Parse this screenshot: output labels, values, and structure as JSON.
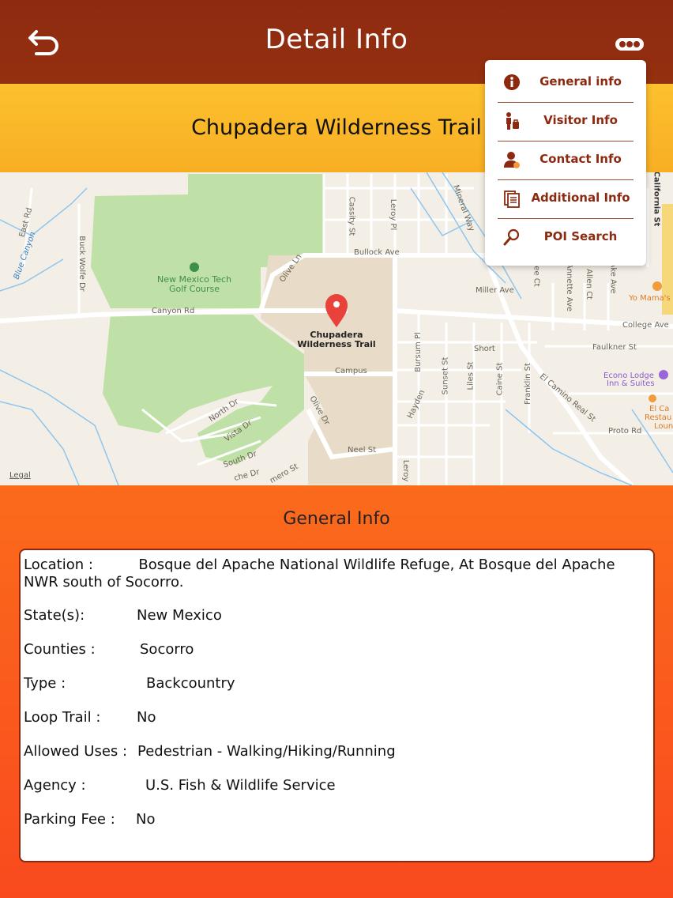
{
  "header": {
    "title": "Detail Info"
  },
  "trail": {
    "name": "Chupadera Wilderness Trail"
  },
  "map": {
    "pin_label": "Chupadera Wilderness Trail",
    "legal": "Legal",
    "golf_label": "New Mexico Tech Golf Course",
    "streets": {
      "east_rd": "East Rd",
      "buck_wolfe": "Buck Wolfe Dr",
      "blue_canyon": "Blue Canyon",
      "canyon_rd": "Canyon Rd",
      "olive_ln": "Olive Ln",
      "bullock": "Bullock Ave",
      "cassity": "Cassity St",
      "leroy": "Leroy Pl",
      "mineral": "Mineral Way",
      "miller": "Miller Ave",
      "campus": "Campus",
      "north_dr": "North Dr",
      "vista_dr": "Vista Dr",
      "south_dr": "South Dr",
      "olive_dr": "Olive Dr",
      "neel": "Neel St",
      "bursum": "Bursum Pl",
      "sunset": "Sunset St",
      "liles": "Liles St",
      "caine": "Caine St",
      "franklin": "Franklin St",
      "hayden": "Hayden",
      "el_camino": "El Camino Real St",
      "short": "Short",
      "faulkner": "Faulkner St",
      "college": "College Ave",
      "proto": "Proto Rd",
      "annette": "Annette Ave",
      "allen": "Allen Ct",
      "ake": "Ake Ave",
      "ee_ct": "ee Ct",
      "california": "California St",
      "leroy2": "Leroy",
      "che_dr": "che Dr",
      "mero": "mero St"
    },
    "pois": {
      "yo_mamas": "Yo Mama's",
      "econo_1": "Econo Lodge",
      "econo_2": "Inn & Suites",
      "el_ca_1": "El Ca",
      "el_ca_2": "Restau",
      "el_ca_3": "Loun"
    }
  },
  "menu": {
    "items": [
      {
        "label": "General info",
        "icon": "info-icon"
      },
      {
        "label": "Visitor Info",
        "icon": "visitor-icon"
      },
      {
        "label": "Contact Info",
        "icon": "contact-icon"
      },
      {
        "label": "Additional Info",
        "icon": "document-icon"
      },
      {
        "label": "POI Search",
        "icon": "magnifier-icon"
      }
    ]
  },
  "general": {
    "title": "General Info",
    "location": {
      "label": "Location :",
      "value": "Bosque del Apache National Wildlife Refuge, At Bosque del Apache NWR",
      "value2": "south of Socorro."
    },
    "states": {
      "label": "State(s):",
      "value": "New Mexico"
    },
    "counties": {
      "label": "Counties :",
      "value": "Socorro"
    },
    "type": {
      "label": "Type :",
      "value": "Backcountry"
    },
    "loop": {
      "label": "Loop Trail  :",
      "value": "No"
    },
    "uses": {
      "label": "Allowed Uses :",
      "value": "Pedestrian - Walking/Hiking/Running"
    },
    "agency": {
      "label": "Agency :",
      "value": "U.S. Fish & Wildlife Service"
    },
    "parking": {
      "label": "Parking Fee :",
      "value": "No"
    }
  },
  "colors": {
    "header": "#8e2a10",
    "band": "#fcc12d",
    "panel": "#fb6b1c",
    "accent": "#8b2a10"
  }
}
